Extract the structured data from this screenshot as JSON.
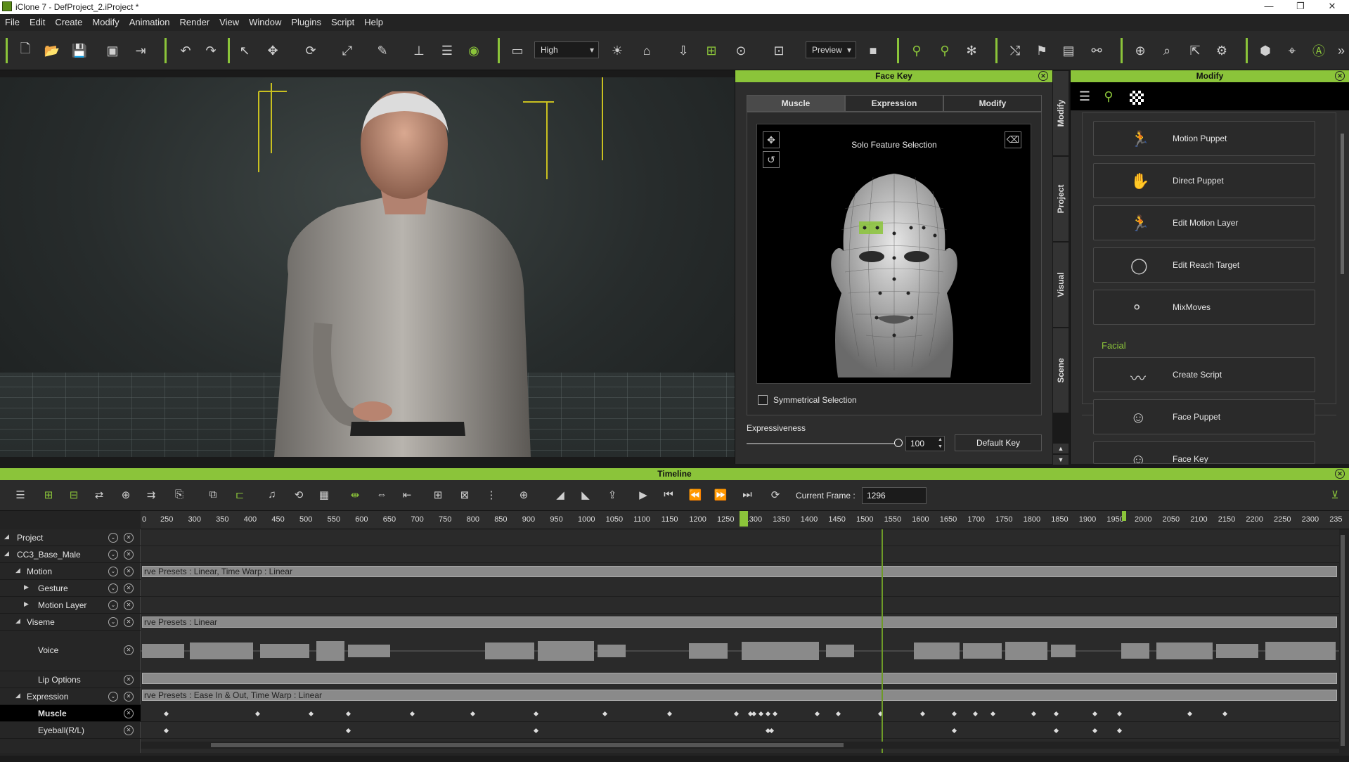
{
  "window": {
    "title": "iClone 7 - DefProject_2.iProject *",
    "controls": [
      "—",
      "❐",
      "✕"
    ]
  },
  "menu": [
    "File",
    "Edit",
    "Create",
    "Modify",
    "Animation",
    "Render",
    "View",
    "Window",
    "Plugins",
    "Script",
    "Help"
  ],
  "toolbar": {
    "quality": "High",
    "preview": "Preview"
  },
  "facekey": {
    "title": "Face Key",
    "tabs": [
      "Muscle",
      "Expression",
      "Modify"
    ],
    "solo": "Solo Feature Selection",
    "symmetrical": "Symmetrical Selection",
    "expressiveness_label": "Expressiveness",
    "expressiveness_value": "100",
    "expressiveness_level": 1.0,
    "default_key": "Default Key"
  },
  "side_tabs": [
    "Modify",
    "Project",
    "Visual",
    "Scene"
  ],
  "modify": {
    "title": "Modify",
    "buttons": [
      "Motion Puppet",
      "Direct Puppet",
      "Edit Motion Layer",
      "Edit Reach Target",
      "MixMoves"
    ],
    "facial_label": "Facial",
    "facial_buttons": [
      "Create Script",
      "Face Puppet",
      "Face Key"
    ]
  },
  "timeline": {
    "title": "Timeline",
    "current_frame_label": "Current Frame :",
    "current_frame": "1296",
    "ruler": [
      "250",
      "300",
      "350",
      "400",
      "450",
      "500",
      "550",
      "600",
      "650",
      "700",
      "750",
      "800",
      "850",
      "900",
      "950",
      "1000",
      "1050",
      "1100",
      "1150",
      "1200",
      "1250",
      "1300",
      "1350",
      "1400",
      "1450",
      "1500",
      "1550",
      "1600",
      "1650",
      "1700",
      "1750",
      "1800",
      "1850",
      "1900",
      "1950",
      "2000",
      "2050",
      "2100",
      "2150",
      "2200",
      "2250",
      "2300",
      "235"
    ],
    "tracks": [
      "Project",
      "CC3_Base_Male",
      "Motion",
      "Gesture",
      "Motion Layer",
      "Viseme",
      "Voice",
      "Lip Options",
      "Expression",
      "Muscle",
      "Eyeball(R/L)"
    ],
    "clips": {
      "motion": "rve Presets : Linear, Time Warp : Linear",
      "viseme": "rve Presets : Linear",
      "expression": "rve Presets : Ease In & Out, Time Warp : Linear"
    }
  },
  "colors": {
    "accent": "#8bc43a",
    "panel": "#2d2d2d"
  }
}
